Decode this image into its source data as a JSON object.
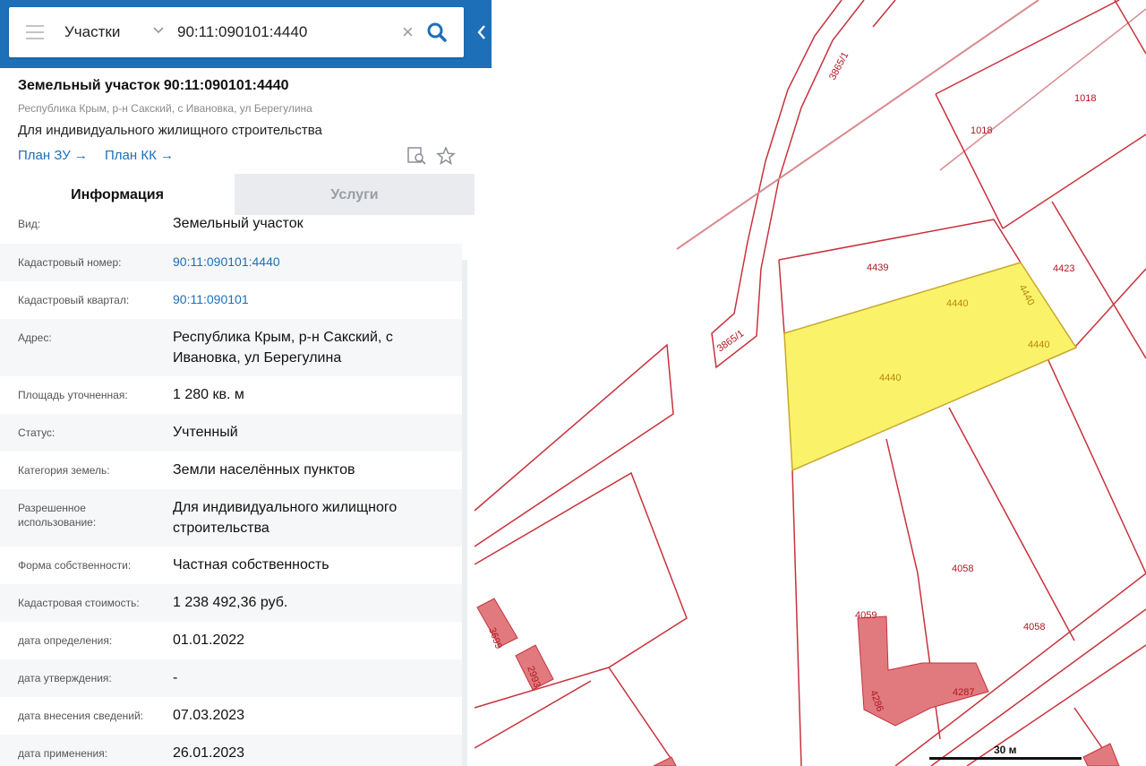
{
  "search": {
    "layer": "Участки",
    "query": "90:11:090101:4440"
  },
  "parcel": {
    "title": "Земельный участок 90:11:090101:4440",
    "address": "Республика Крым, р-н Сакский, с Ивановка, ул Берегулина",
    "use": "Для индивидуального жилищного строительства",
    "links": [
      "План ЗУ →",
      "План КК →"
    ]
  },
  "tabs": [
    "Информация",
    "Услуги"
  ],
  "rows": [
    {
      "key": "Вид:",
      "value": "Земельный участок"
    },
    {
      "key": "Кадастровый номер:",
      "value": "90:11:090101:4440",
      "link": true
    },
    {
      "key": "Кадастровый квартал:",
      "value": "90:11:090101",
      "link": true
    },
    {
      "key": "Адрес:",
      "value": "Республика Крым, р-н Сакский, с Ивановка, ул Берегулина"
    },
    {
      "key": "Площадь уточненная:",
      "value": "1 280 кв. м"
    },
    {
      "key": "Статус:",
      "value": "Учтенный"
    },
    {
      "key": "Категория земель:",
      "value": "Земли населённых пунктов"
    },
    {
      "key": "Разрешенное использование:",
      "value": "Для индивидуального жилищного строительства"
    },
    {
      "key": "Форма собственности:",
      "value": "Частная собственность"
    },
    {
      "key": "Кадастровая стоимость:",
      "value": "1 238 492,36 руб."
    },
    {
      "key": "дата определения:",
      "value": "01.01.2022"
    },
    {
      "key": "дата утверждения:",
      "value": "-"
    },
    {
      "key": "дата внесения сведений:",
      "value": "07.03.2023"
    },
    {
      "key": "дата применения:",
      "value": "26.01.2023"
    }
  ],
  "map": {
    "labels": {
      "l3865_1a": "3865/1",
      "l3865_1b": "3865/1",
      "l1018a": "1018",
      "l1018b": "1018",
      "l4439": "4439",
      "l4423": "4423",
      "l4440a": "4440",
      "l4440b": "4440",
      "l4440c": "4440",
      "l4440d": "4440",
      "l4058a": "4058",
      "l4058b": "4058",
      "l4059": "4059",
      "l4286": "4286",
      "l4287": "4287",
      "l3699": "3699",
      "l2993": "2993"
    },
    "scale": "30 м",
    "colors": {
      "boundary": "#c8323c",
      "selected": "#faf36a",
      "building": "#e07a7e"
    }
  }
}
